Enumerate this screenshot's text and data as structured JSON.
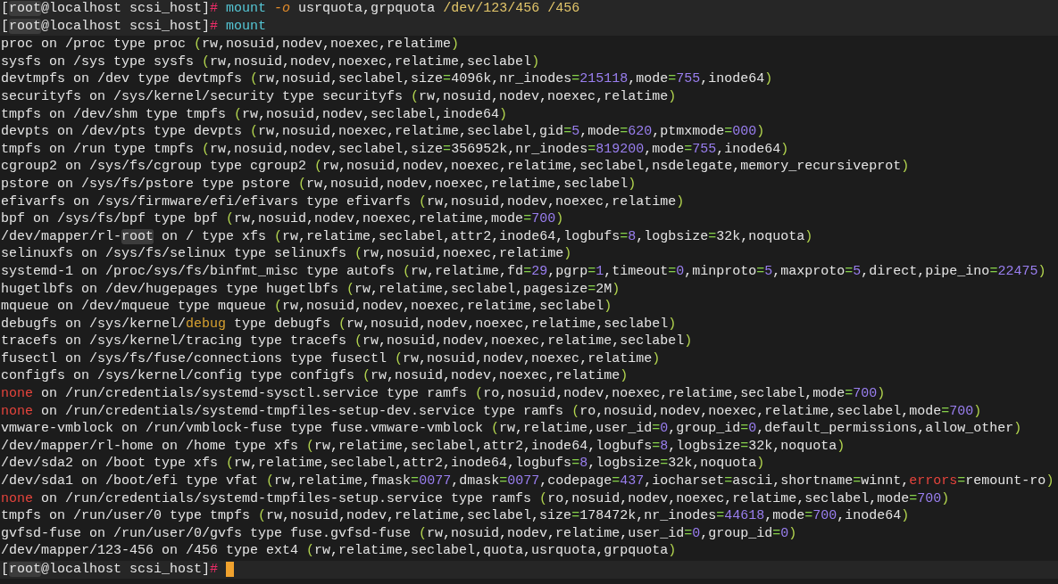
{
  "history": [
    [
      {
        "text": "[",
        "kind": "plain"
      },
      {
        "text": "root",
        "kind": "user"
      },
      {
        "text": "@localhost scsi_host]",
        "kind": "plain"
      },
      {
        "text": "#",
        "kind": "sign"
      },
      {
        "text": " mount",
        "kind": "cmd"
      },
      {
        "text": " -o",
        "kind": "flag"
      },
      {
        "text": " usrquota,grpquota ",
        "kind": "plain"
      },
      {
        "text": "/dev/123/456 /456",
        "kind": "path"
      }
    ],
    [
      {
        "text": "[",
        "kind": "plain"
      },
      {
        "text": "root",
        "kind": "user"
      },
      {
        "text": "@localhost scsi_host]",
        "kind": "plain"
      },
      {
        "text": "#",
        "kind": "sign"
      },
      {
        "text": " mount",
        "kind": "cmd"
      }
    ]
  ],
  "output": [
    [
      {
        "text": "proc on /proc type proc (rw,nosuid,nodev,noexec,relatime)",
        "kind": "plain"
      }
    ],
    [
      {
        "text": "sysfs on /sys type sysfs (rw,nosuid,nodev,noexec,relatime,seclabel)",
        "kind": "plain"
      }
    ],
    [
      {
        "text": "devtmpfs on /dev type devtmpfs (rw,nosuid,seclabel,size=4096k,nr_inodes=215118,mode=755,inode64)",
        "kind": "plain"
      }
    ],
    [
      {
        "text": "securityfs on /sys/kernel/security type securityfs (rw,nosuid,nodev,noexec,relatime)",
        "kind": "plain"
      }
    ],
    [
      {
        "text": "tmpfs on /dev/shm type tmpfs (rw,nosuid,nodev,seclabel,inode64)",
        "kind": "plain"
      }
    ],
    [
      {
        "text": "devpts on /dev/pts type devpts (rw,nosuid,noexec,relatime,seclabel,gid=5,mode=620,ptmxmode=000)",
        "kind": "plain"
      }
    ],
    [
      {
        "text": "tmpfs on /run type tmpfs (rw,nosuid,nodev,seclabel,size=356952k,nr_inodes=819200,mode=755,inode64)",
        "kind": "plain"
      }
    ],
    [
      {
        "text": "cgroup2 on /sys/fs/cgroup type cgroup2 (rw,nosuid,nodev,noexec,relatime,seclabel,nsdelegate,memory_recursiveprot)",
        "kind": "plain"
      }
    ],
    [
      {
        "text": "pstore on /sys/fs/pstore type pstore (rw,nosuid,nodev,noexec,relatime,seclabel)",
        "kind": "plain"
      }
    ],
    [
      {
        "text": "efivarfs on /sys/firmware/efi/efivars type efivarfs (rw,nosuid,nodev,noexec,relatime)",
        "kind": "plain"
      }
    ],
    [
      {
        "text": "bpf on /sys/fs/bpf type bpf (rw,nosuid,nodev,noexec,relatime,mode=700)",
        "kind": "plain"
      }
    ],
    [
      {
        "text": "/dev/mapper/rl-",
        "kind": "plain"
      },
      {
        "text": "root",
        "kind": "user"
      },
      {
        "text": " on / type xfs (rw,relatime,seclabel,attr2,inode64,logbufs=8,logbsize=32k,noquota)",
        "kind": "plain"
      }
    ],
    [
      {
        "text": "selinuxfs on /sys/fs/selinux type selinuxfs (rw,nosuid,noexec,relatime)",
        "kind": "plain"
      }
    ],
    [
      {
        "text": "systemd-1 on /proc/sys/fs/binfmt_misc type autofs (rw,relatime,fd=29,pgrp=1,timeout=0,minproto=5,maxproto=5,direct,pipe_ino=22475)",
        "kind": "plain"
      }
    ],
    [
      {
        "text": "hugetlbfs on /dev/hugepages type hugetlbfs (rw,relatime,seclabel,pagesize=2M)",
        "kind": "plain"
      }
    ],
    [
      {
        "text": "mqueue on /dev/mqueue type mqueue (rw,nosuid,nodev,noexec,relatime,seclabel)",
        "kind": "plain"
      }
    ],
    [
      {
        "text": "debugfs on /sys/kernel/",
        "kind": "plain"
      },
      {
        "text": "debug",
        "kind": "warn"
      },
      {
        "text": " type debugfs (rw,nosuid,nodev,noexec,relatime,seclabel)",
        "kind": "plain"
      }
    ],
    [
      {
        "text": "tracefs on /sys/kernel/tracing type tracefs (rw,nosuid,nodev,noexec,relatime,seclabel)",
        "kind": "plain"
      }
    ],
    [
      {
        "text": "fusectl on /sys/fs/fuse/connections type fusectl (rw,nosuid,nodev,noexec,relatime)",
        "kind": "plain"
      }
    ],
    [
      {
        "text": "configfs on /sys/kernel/config type configfs (rw,nosuid,nodev,noexec,relatime)",
        "kind": "plain"
      }
    ],
    [
      {
        "text": "none",
        "kind": "alert"
      },
      {
        "text": " on /run/credentials/systemd-sysctl.service type ramfs (ro,nosuid,nodev,noexec,relatime,seclabel,mode=700)",
        "kind": "plain"
      }
    ],
    [
      {
        "text": "none",
        "kind": "alert"
      },
      {
        "text": " on /run/credentials/systemd-tmpfiles-setup-dev.service type ramfs (ro,nosuid,nodev,noexec,relatime,seclabel,mode=700)",
        "kind": "plain"
      }
    ],
    [
      {
        "text": "vmware-vmblock on /run/vmblock-fuse type fuse.vmware-vmblock (rw,relatime,user_id=0,group_id=0,default_permissions,allow_other)",
        "kind": "plain"
      }
    ],
    [
      {
        "text": "/dev/mapper/rl-home on /home type xfs (rw,relatime,seclabel,attr2,inode64,logbufs=8,logbsize=32k,noquota)",
        "kind": "plain"
      }
    ],
    [
      {
        "text": "/dev/sda2 on /boot type xfs (rw,relatime,seclabel,attr2,inode64,logbufs=8,logbsize=32k,noquota)",
        "kind": "plain"
      }
    ],
    [
      {
        "text": "/dev/sda1 on /boot/efi type vfat (rw,relatime,fmask=0077,dmask=0077,codepage=437,iocharset=ascii,shortname=winnt,",
        "kind": "plain"
      },
      {
        "text": "errors",
        "kind": "alert"
      },
      {
        "text": "=remount-ro)",
        "kind": "plain"
      }
    ],
    [
      {
        "text": "none",
        "kind": "alert"
      },
      {
        "text": " on /run/credentials/systemd-tmpfiles-setup.service type ramfs (ro,nosuid,nodev,noexec,relatime,seclabel,mode=700)",
        "kind": "plain"
      }
    ],
    [
      {
        "text": "tmpfs on /run/user/0 type tmpfs (rw,nosuid,nodev,relatime,seclabel,size=178472k,nr_inodes=44618,mode=700,inode64)",
        "kind": "plain"
      }
    ],
    [
      {
        "text": "gvfsd-fuse on /run/user/0/gvfs type fuse.gvfsd-fuse (rw,nosuid,nodev,relatime,user_id=0,group_id=0)",
        "kind": "plain"
      }
    ],
    [
      {
        "text": "/dev/mapper/123-456 on /456 type ext4 (rw,relatime,seclabel,quota,usrquota,grpquota)",
        "kind": "plain"
      }
    ]
  ],
  "prompt": [
    {
      "text": "[",
      "kind": "plain"
    },
    {
      "text": "root",
      "kind": "user"
    },
    {
      "text": "@localhost scsi_host]",
      "kind": "plain"
    },
    {
      "text": "#",
      "kind": "sign"
    }
  ]
}
